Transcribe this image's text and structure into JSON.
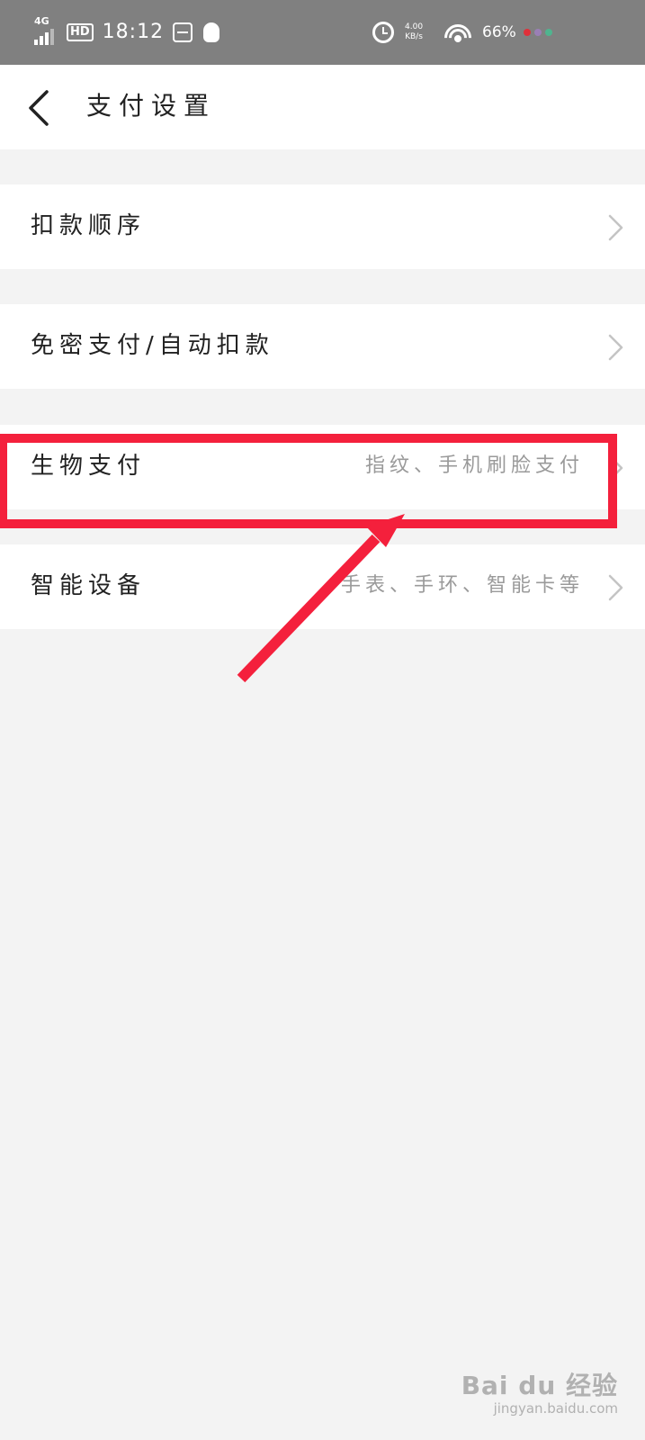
{
  "status_bar": {
    "network": "4G",
    "hd": "HD",
    "time": "18:12",
    "speed_value": "4.00",
    "speed_unit": "KB/s",
    "battery": "66%",
    "icons": [
      "signal-icon",
      "hd-icon",
      "app-icon",
      "qq-icon",
      "alarm-icon",
      "wifi-icon"
    ],
    "dot_colors": [
      "#e0303a",
      "#9a7fb5",
      "#4fb48f"
    ]
  },
  "header": {
    "back_icon": "chevron-left-icon",
    "title": "支付设置"
  },
  "settings": {
    "items": [
      {
        "label": "扣款顺序",
        "value": ""
      },
      {
        "label": "免密支付/自动扣款",
        "value": ""
      },
      {
        "label": "生物支付",
        "value": "指纹、手机刷脸支付"
      },
      {
        "label": "智能设备",
        "value": "手表、手环、智能卡等"
      }
    ],
    "chevron_icon": "chevron-right-icon"
  },
  "annotation": {
    "color": "#f4203c",
    "highlighted_item": "生物支付"
  },
  "watermark": {
    "main": "Bai du 经验",
    "sub": "jingyan.baidu.com"
  }
}
